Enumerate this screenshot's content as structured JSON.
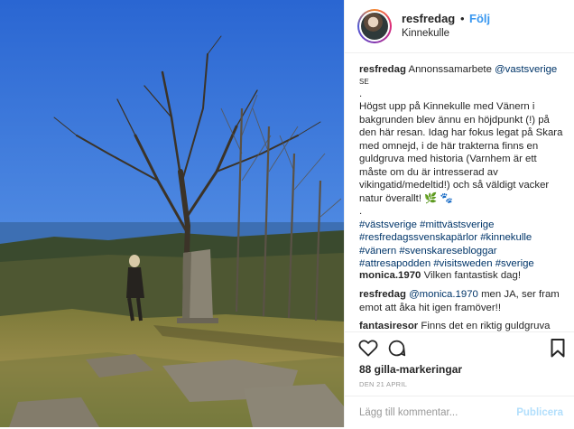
{
  "photo": {
    "alt": ""
  },
  "header": {
    "username": "resfredag",
    "separator": "•",
    "follow_label": "Följ",
    "location": "Kinnekulle"
  },
  "caption": {
    "username": "resfredag",
    "partnership": "Annonssamarbete",
    "mention": "@vastsverige",
    "lang": "SE",
    "dot": ".",
    "text": "Högst upp på Kinnekulle med Vänern i bakgrunden blev ännu en höjdpunkt (!) på den här resan. Idag har fokus legat på Skara med omnejd, i de här trakterna finns en guldgruva med historia (Varnhem är ett måste om du är intresserad av vikingatid/medeltid!) och så väldigt vacker natur överallt! 🌿 🐾",
    "dot2": ".",
    "hashtags": "#västsverige #mittvästsverige #resfredagssvenskapärlor #kinnekulle #vänern #svenskaresebloggar #attresapodden #visitsweden #sverige"
  },
  "comments": [
    {
      "username": "monica.1970",
      "text": "Vilken fantastisk dag!"
    },
    {
      "username": "resfredag",
      "mention": "@monica.1970",
      "text": "men JA, ser fram emot att åka hit igen framöver!!"
    },
    {
      "username": "fantasiresor",
      "text": "Finns det en riktig guldgruva"
    }
  ],
  "actions": {
    "likes": "88 gilla-markeringar",
    "date": "DEN 21 APRIL",
    "comment_placeholder": "Lägg till kommentar...",
    "publish_label": "Publicera"
  },
  "colors": {
    "link": "#003569",
    "follow": "#3897f0",
    "sky": "#2f6fd6"
  },
  "icons": [
    "heart-icon",
    "comment-icon",
    "bookmark-icon"
  ]
}
